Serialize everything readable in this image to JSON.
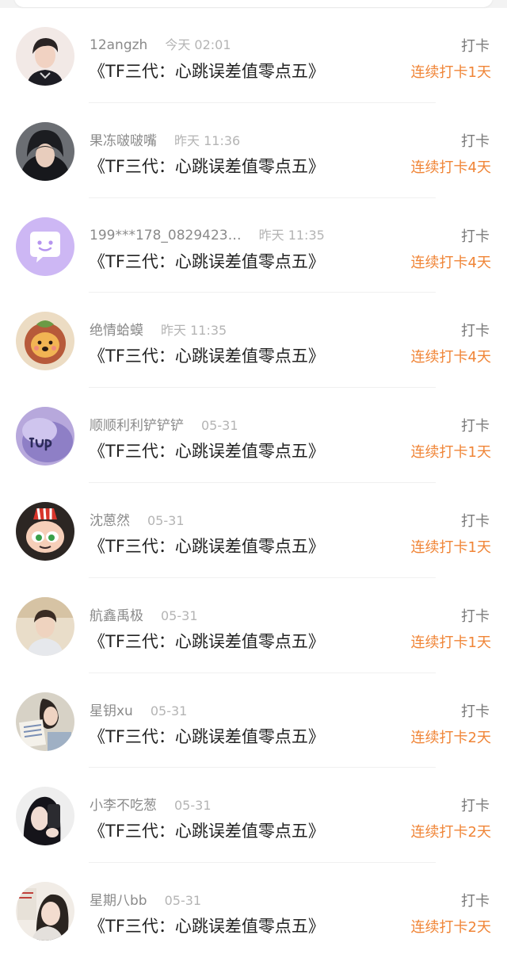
{
  "colors": {
    "accent": "#f08537",
    "name": "#8a8a8a",
    "time": "#b4b4b4",
    "title": "#222222",
    "action": "#7a7a7a",
    "divider": "#f0f0f0"
  },
  "checkins": [
    {
      "name": "12angzh",
      "time": "今天 02:01",
      "title": "《TF三代：心跳误差值零点五》",
      "action": "打卡",
      "streak": "连续打卡1天",
      "avatar_icon": "user-photo-avatar"
    },
    {
      "name": "果冻啵啵嘴",
      "time": "昨天 11:36",
      "title": "《TF三代：心跳误差值零点五》",
      "action": "打卡",
      "streak": "连续打卡4天",
      "avatar_icon": "user-photo-avatar"
    },
    {
      "name": "199***178_0829423…",
      "time": "昨天 11:35",
      "title": "《TF三代：心跳误差值零点五》",
      "action": "打卡",
      "streak": "连续打卡4天",
      "avatar_icon": "default-chat-bubble-avatar"
    },
    {
      "name": "绝情蛤蟆",
      "time": "昨天 11:35",
      "title": "《TF三代：心跳误差值零点五》",
      "action": "打卡",
      "streak": "连续打卡4天",
      "avatar_icon": "cartoon-lion-avatar"
    },
    {
      "name": "顺顺利利铲铲铲",
      "time": "05-31",
      "title": "《TF三代：心跳误差值零点五》",
      "action": "打卡",
      "streak": "连续打卡1天",
      "avatar_icon": "user-photo-avatar"
    },
    {
      "name": "沈蒽然",
      "time": "05-31",
      "title": "《TF三代：心跳误差值零点五》",
      "action": "打卡",
      "streak": "连续打卡1天",
      "avatar_icon": "cartoon-character-avatar"
    },
    {
      "name": "航鑫禹极",
      "time": "05-31",
      "title": "《TF三代：心跳误差值零点五》",
      "action": "打卡",
      "streak": "连续打卡1天",
      "avatar_icon": "user-photo-avatar"
    },
    {
      "name": "星钥xu",
      "time": "05-31",
      "title": "《TF三代：心跳误差值零点五》",
      "action": "打卡",
      "streak": "连续打卡2天",
      "avatar_icon": "user-photo-avatar"
    },
    {
      "name": "小李不吃葱",
      "time": "05-31",
      "title": "《TF三代：心跳误差值零点五》",
      "action": "打卡",
      "streak": "连续打卡2天",
      "avatar_icon": "user-photo-avatar"
    },
    {
      "name": "星期八bb",
      "time": "05-31",
      "title": "《TF三代：心跳误差值零点五》",
      "action": "打卡",
      "streak": "连续打卡2天",
      "avatar_icon": "user-photo-avatar"
    }
  ]
}
